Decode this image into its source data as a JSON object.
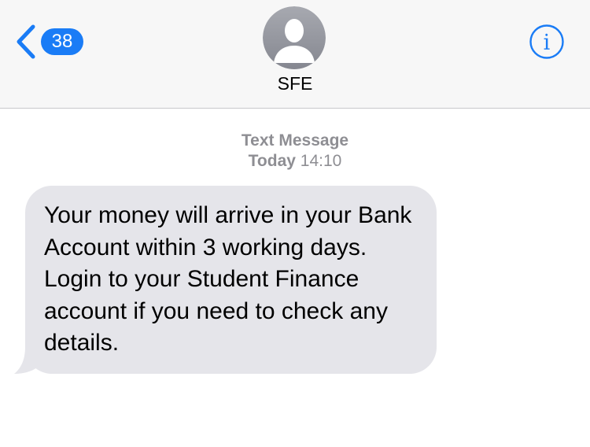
{
  "nav": {
    "unread_count": "38",
    "contact_name": "SFE"
  },
  "thread": {
    "service_label": "Text Message",
    "day_label": "Today",
    "time_label": "14:10"
  },
  "messages": [
    {
      "direction": "incoming",
      "text": "Your money will arrive in your Bank Account within 3 working days. Login to your Student Finance account if you need to check any details."
    }
  ],
  "colors": {
    "accent": "#1a7cf6",
    "incoming_bubble": "#e5e5ea",
    "meta_text": "#8e8e93",
    "header_bg": "#f7f7f7"
  },
  "icons": {
    "back": "chevron-left-icon",
    "avatar": "person-silhouette-icon",
    "info": "info-circle-icon"
  }
}
